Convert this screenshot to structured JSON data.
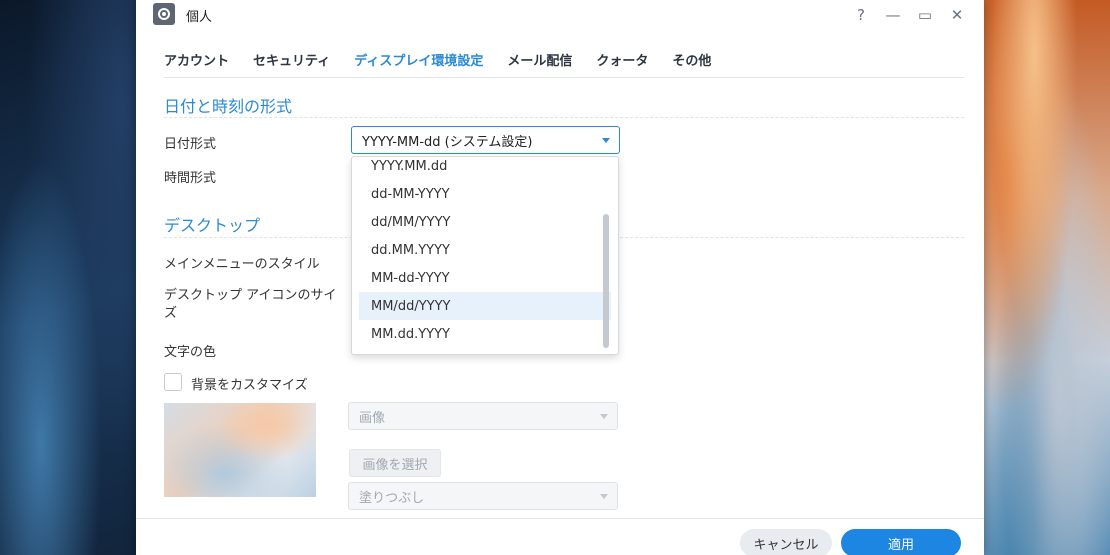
{
  "window": {
    "title": "個人",
    "controls": {
      "help": "?",
      "minimize": "—",
      "maximize": "▭",
      "close": "✕"
    }
  },
  "tabs": [
    {
      "label": "アカウント",
      "active": false
    },
    {
      "label": "セキュリティ",
      "active": false
    },
    {
      "label": "ディスプレイ環境設定",
      "active": true
    },
    {
      "label": "メール配信",
      "active": false
    },
    {
      "label": "クォータ",
      "active": false
    },
    {
      "label": "その他",
      "active": false
    }
  ],
  "datetime": {
    "title": "日付と時刻の形式",
    "date_label": "日付形式",
    "date_value": "YYYY-MM-dd (システム設定)",
    "time_label": "時間形式"
  },
  "dropdown": {
    "options": [
      "YYYY.MM.dd",
      "dd-MM-YYYY",
      "dd/MM/YYYY",
      "dd.MM.YYYY",
      "MM-dd-YYYY",
      "MM/dd/YYYY",
      "MM.dd.YYYY"
    ],
    "hovered_option": "MM/dd/YYYY"
  },
  "desktop": {
    "title": "デスクトップ",
    "menu_style_label": "メインメニューのスタイル",
    "icon_size_label": "デスクトップ アイコンのサイズ",
    "text_color_label": "文字の色",
    "custom_bg_label": "背景をカスタマイズ",
    "image_select_value": "画像",
    "select_image_button": "画像を選択",
    "fill_select_value": "塗りつぶし"
  },
  "footer": {
    "cancel": "キャンセル",
    "apply": "適用"
  },
  "colors": {
    "accent": "#2b8ad6",
    "apply_button": "#1d86e2"
  }
}
